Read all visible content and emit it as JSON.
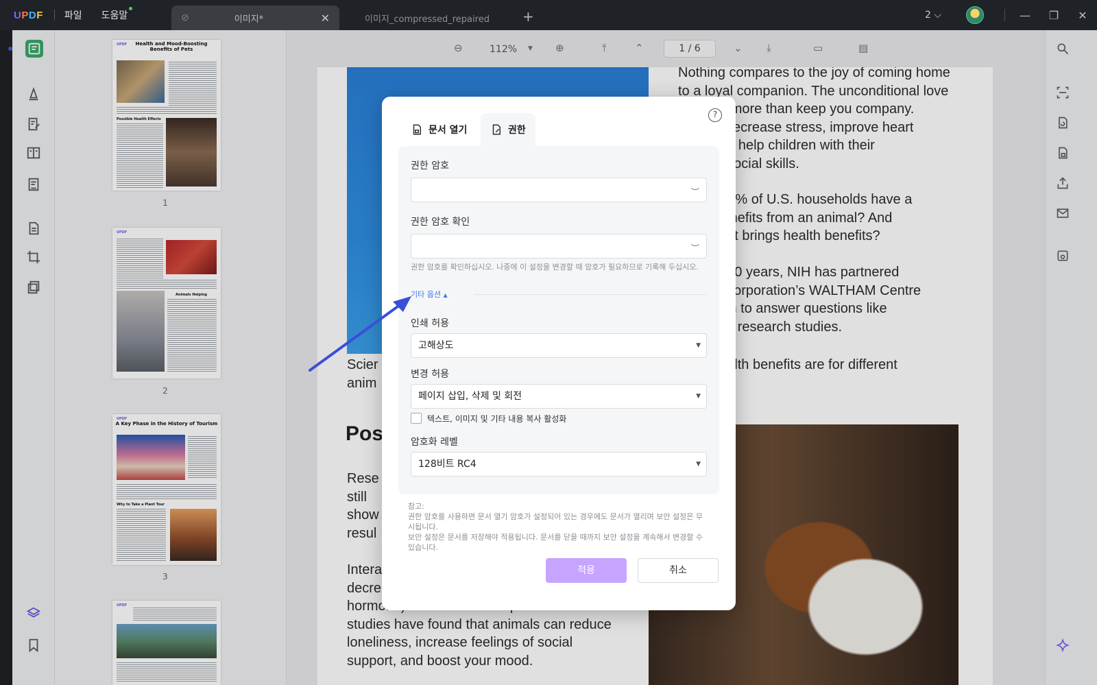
{
  "app": {
    "logo": "UPDF",
    "menu": [
      "파일",
      "도움말"
    ],
    "tabs": [
      {
        "title": "이미지*",
        "active": true
      },
      {
        "title": "이미지_compressed_repaired",
        "active": false
      }
    ],
    "window_count": "2 ⌵"
  },
  "toolbar": {
    "zoom": "112%",
    "page_current": "1",
    "page_total": "6",
    "page_indicator": "1  /  6"
  },
  "thumbnails": [
    {
      "number": "1",
      "title": "Health and Mood-Boosting Benefits of Pets",
      "heading": "Possible Health Effects",
      "logo": "UPDF"
    },
    {
      "number": "2",
      "title": "",
      "heading": "Animals Helping People",
      "logo": "UPDF"
    },
    {
      "number": "3",
      "title": "A Key Phase in the History of Tourism",
      "heading": "Why to Take a Plant Tour",
      "logo": "UPDF"
    },
    {
      "number": "",
      "title": "",
      "heading": "",
      "logo": "UPDF"
    }
  ],
  "document": {
    "para1": "Nothing compares to the joy of coming home to a loyal companion. The unconditional love ... can do more than keep you company. ...ay also decrease stress, improve heart ... and even help children with their ...nal and social skills.",
    "para1_lines": [
      "Nothing compares to the joy of coming home",
      "to a loyal companion. The unconditional love",
      "t can do more than keep you company.",
      "ay also decrease stress, improve heart",
      "and even help children with their",
      "nal and social skills."
    ],
    "para2_lines": [
      "mated 68% of U.S. households have a",
      "t who benefits from an animal? And",
      "ype of pet brings health benefits?"
    ],
    "para3_lines": [
      "ne past 10 years, NIH has partnered",
      "e Mars Corporation’s WALTHAM Centre",
      "t Nutrition to answer questions like",
      "y funding research studies."
    ],
    "para4_left": [
      "Scier",
      "anim"
    ],
    "para4_right": "ental health benefits are for different",
    "heading": "Pos",
    "para5_left": [
      "Rese",
      "still",
      "show",
      "resul"
    ],
    "para6_lines": [
      "Intera",
      "decre",
      "hormone) and lower blood pressure. Other",
      "studies have found that animals can reduce",
      "loneliness, increase feelings of social",
      "support, and boost your mood."
    ]
  },
  "dialog": {
    "tab_open": "문서 열기",
    "tab_permission": "권한",
    "help": "?",
    "perm_password_label": "권한 암호",
    "perm_password_value": "",
    "perm_confirm_label": "권한 암호 확인",
    "perm_confirm_value": "",
    "hint": "권한 암호를 확인하십시오. 나중에 이 설정을 변경할 때 암호가 필요하므로 기록해 두십시오.",
    "more_options": "기타 옵션",
    "print_label": "인쇄 허용",
    "print_value": "고해상도",
    "change_label": "변경 허용",
    "change_value": "페이지 삽입, 삭제 및 회전",
    "copy_checkbox": "텍스트, 이미지 및 기타 내용 복사 활성화",
    "copy_checked": false,
    "encryption_label": "암호화 레벨",
    "encryption_value": "128비트 RC4",
    "note_title": "참고:",
    "note_1": "권한 암호를 사용하면 문서 열기 암호가 설정되어 있는 경우에도 문서가 열리며 보안 설정은 무시됩니다.",
    "note_2": "보안 설정은 문서를 저장해야 적용됩니다. 문서를 닫을 때까지 보안 설정을 계속해서 변경할 수 있습니다.",
    "apply": "적용",
    "cancel": "취소"
  },
  "colors": {
    "accent": "#c6a4ff",
    "link": "#3b7be8",
    "active_tool": "#39a86a",
    "arrow": "#3b4fd6"
  }
}
